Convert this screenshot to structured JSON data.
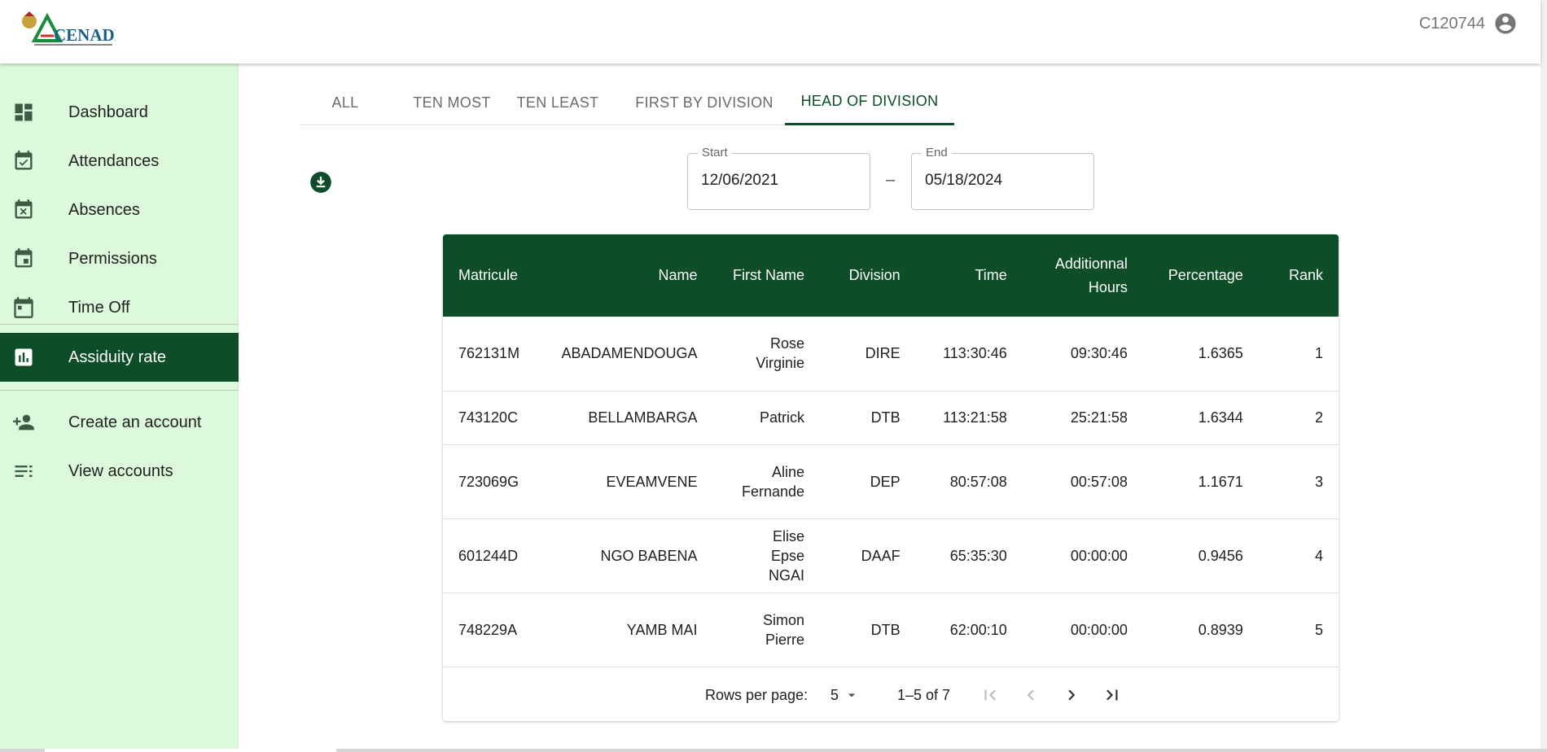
{
  "header": {
    "logo_text": "CENADI",
    "user_id": "C120744"
  },
  "sidebar": {
    "items": [
      {
        "label": "Dashboard",
        "icon": "dashboard-icon"
      },
      {
        "label": "Attendances",
        "icon": "event-available-icon"
      },
      {
        "label": "Absences",
        "icon": "event-busy-icon"
      },
      {
        "label": "Permissions",
        "icon": "event-icon"
      },
      {
        "label": "Time Off",
        "icon": "calendar-today-icon"
      },
      {
        "label": "Assiduity rate",
        "icon": "bar-chart-icon",
        "active": true
      },
      {
        "label": "Create an account",
        "icon": "person-add-icon"
      },
      {
        "label": "View accounts",
        "icon": "list-icon"
      }
    ]
  },
  "tabs": [
    "ALL",
    "TEN MOST",
    "TEN LEAST",
    "FIRST BY DIVISION",
    "HEAD OF DIVISION"
  ],
  "active_tab": "HEAD OF DIVISION",
  "filters": {
    "start_label": "Start",
    "start_value": "12/06/2021",
    "separator": "–",
    "end_label": "End",
    "end_value": "05/18/2024"
  },
  "table": {
    "headers": [
      "Matricule",
      "Name",
      "First Name",
      "Division",
      "Time",
      "Additionnal Hours",
      "Percentage",
      "Rank"
    ],
    "rows": [
      [
        "762131M",
        "ABADAMENDOUGA",
        "Rose Virginie",
        "DIRE",
        "113:30:46",
        "09:30:46",
        "1.6365",
        "1"
      ],
      [
        "743120C",
        "BELLAMBARGA",
        "Patrick",
        "DTB",
        "113:21:58",
        "25:21:58",
        "1.6344",
        "2"
      ],
      [
        "723069G",
        "EVEAMVENE",
        "Aline Fernande",
        "DEP",
        "80:57:08",
        "00:57:08",
        "1.1671",
        "3"
      ],
      [
        "601244D",
        "NGO BABENA",
        "Elise Epse NGAI",
        "DAAF",
        "65:35:30",
        "00:00:00",
        "0.9456",
        "4"
      ],
      [
        "748229A",
        "YAMB MAI",
        "Simon Pierre",
        "DTB",
        "62:00:10",
        "00:00:00",
        "0.8939",
        "5"
      ]
    ]
  },
  "pagination": {
    "rows_per_page_label": "Rows per page:",
    "rows_per_page_value": "5",
    "range": "1–5 of 7"
  },
  "colors": {
    "primary": "#0d4d27",
    "sidebar_bg": "#dcfadb"
  }
}
